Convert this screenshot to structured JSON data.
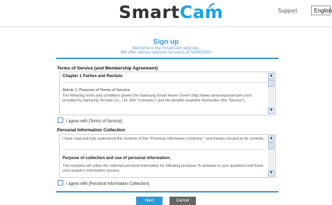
{
  "header": {
    "logo_smart": "Smart",
    "logo_cam": "Cam",
    "support_label": "Support",
    "language": "English"
  },
  "page": {
    "title": "Sign up",
    "subtitle_1": "Welcome to the SmartCam web site.",
    "subtitle_2": "We offer various services for users of SAMSUNG"
  },
  "terms": {
    "section_title": "Terms of Service (and Membership Agreement)",
    "chapter": "Chapter 1 Parties and Recitals",
    "article": "Article 1. Purpose of Terms of Service",
    "body": "The following terms and conditions govern the Samsung Smart Home Center (http://www.samsungsmartcam.com) provided by Samsung Techwin Co., Ltd. (the \"Company\") and the benefits available thereunder (the \"Service\").",
    "agree_label": "I agree with [Terms of Service]."
  },
  "privacy": {
    "section_title": "Personal Information Collection",
    "intro": "I have read and fully understood the contents of this \"Personal Information Collection \" and hereby consent to its contents.",
    "heading": "Purpose of collection and use of personal information.",
    "body": "The company will utilize the collected personal information for following purposes To answers to your questions and Keep your answer's information secures.",
    "agree_label": "I agree with [Personal Information Collection]."
  },
  "buttons": {
    "next": "Next",
    "cancel": "Cancel"
  },
  "colors": {
    "accent": "#3399cc",
    "logo_cam": "#1aa3e1",
    "next_button": "#2b99d6",
    "cancel_button": "#666666"
  }
}
